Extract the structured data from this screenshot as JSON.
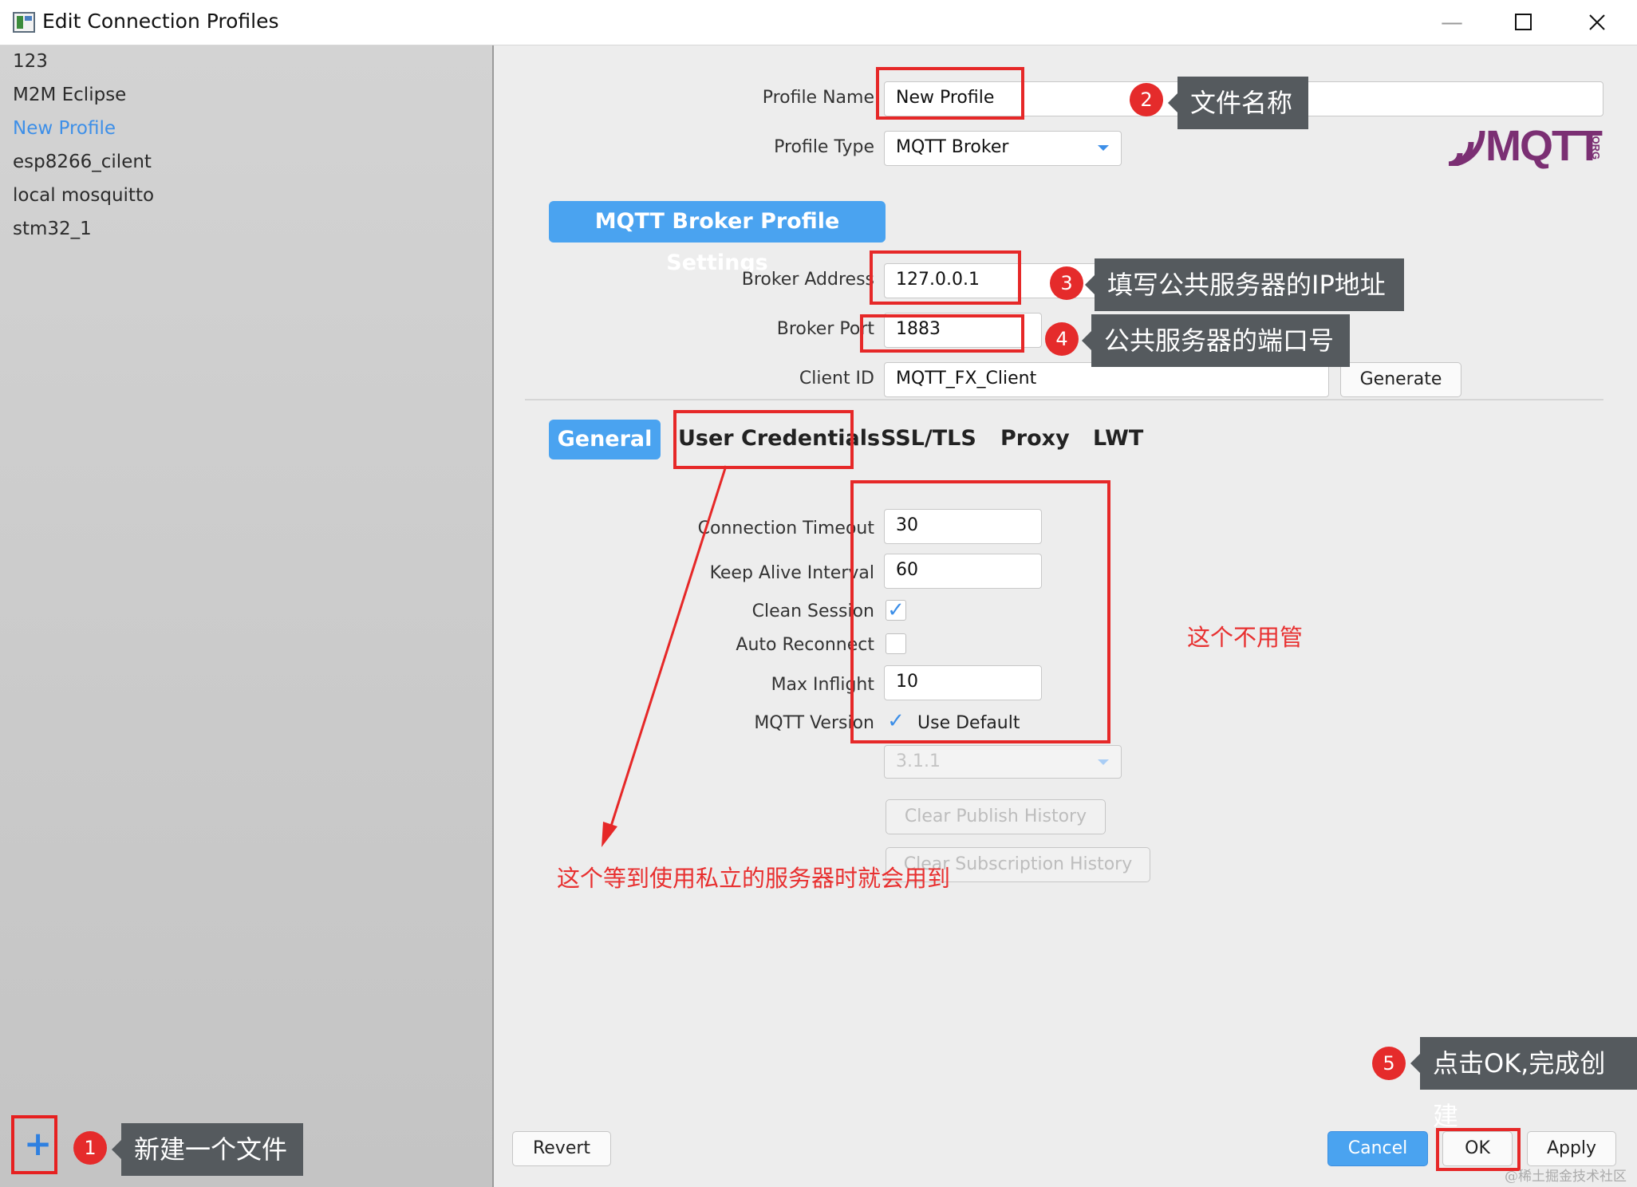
{
  "window": {
    "title": "Edit Connection Profiles",
    "min_glyph": "—",
    "max_glyph": "☐",
    "close_glyph": "✕"
  },
  "sidebar": {
    "items": [
      "123",
      "M2M Eclipse",
      "New Profile",
      "esp8266_cilent",
      "local mosquitto",
      "stm32_1"
    ],
    "active_index": 2,
    "add_icon": "plus-icon",
    "add_glyph": "+"
  },
  "profile": {
    "name_label": "Profile Name",
    "name_value": "New Profile",
    "type_label": "Profile Type",
    "type_value": "MQTT Broker",
    "logo_text": "MQTT",
    "logo_org": ".ORG"
  },
  "broker": {
    "section_title": "MQTT Broker Profile Settings",
    "address_label": "Broker Address",
    "address_value": "127.0.0.1",
    "port_label": "Broker Port",
    "port_value": "1883",
    "client_id_label": "Client ID",
    "client_id_value": "MQTT_FX_Client",
    "generate_label": "Generate"
  },
  "tabs": [
    "General",
    "User Credentials",
    "SSL/TLS",
    "Proxy",
    "LWT"
  ],
  "general": {
    "timeout_label": "Connection Timeout",
    "timeout_value": "30",
    "keepalive_label": "Keep Alive Interval",
    "keepalive_value": "60",
    "clean_session_label": "Clean Session",
    "clean_session_checked": true,
    "auto_reconnect_label": "Auto Reconnect",
    "auto_reconnect_checked": false,
    "max_inflight_label": "Max Inflight",
    "max_inflight_value": "10",
    "mqtt_version_label": "MQTT Version",
    "use_default_label": "Use Default",
    "use_default_checked": true,
    "version_value": "3.1.1",
    "clear_publish_label": "Clear Publish History",
    "clear_subscription_label": "Clear Subscription History"
  },
  "footer": {
    "revert": "Revert",
    "cancel": "Cancel",
    "ok": "OK",
    "apply": "Apply"
  },
  "annotations": {
    "callout1": "新建一个文件",
    "callout2": "文件名称",
    "callout3": "填写公共服务器的IP地址",
    "callout4": "公共服务器的端口号",
    "callout5": "点击OK,完成创建",
    "note_general": "这个不用管",
    "note_credentials": "这个等到使用私立的服务器时就会用到",
    "badges": [
      "1",
      "2",
      "3",
      "4",
      "5"
    ],
    "watermark": "@稀土掘金技术社区",
    "colors": {
      "annotation_red": "#e62828",
      "callout_bg": "#555a5e",
      "accent_blue": "#4aa3f0"
    }
  }
}
